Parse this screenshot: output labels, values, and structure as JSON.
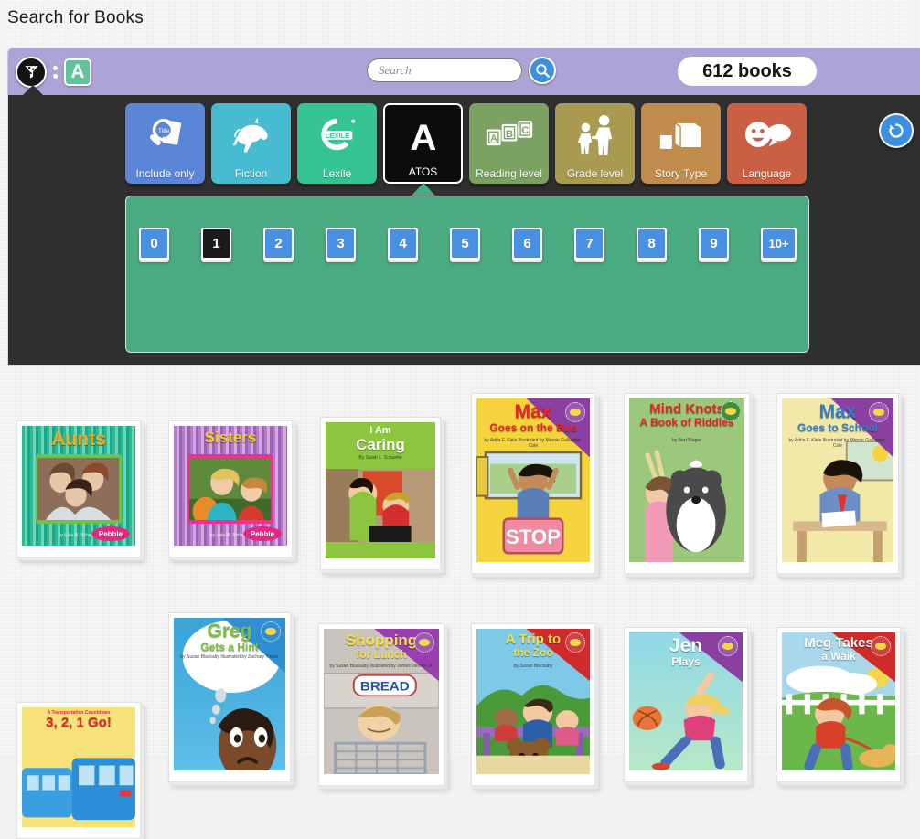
{
  "page": {
    "title": "Search for Books"
  },
  "filter_bar": {
    "funnel_icon": "filter-funnel-icon",
    "separator": ":",
    "active_filter_letter": "A",
    "search": {
      "value": "",
      "placeholder": "Search"
    },
    "search_button_icon": "magnifier-icon",
    "book_count": "612 books"
  },
  "categories": [
    {
      "id": "include-only",
      "label": "Include only",
      "color": "#5b86d8",
      "icon": "magnifier-over-books-icon",
      "selected": false
    },
    {
      "id": "fiction",
      "label": "Fiction",
      "color": "#47bcd0",
      "icon": "unicorn-icon",
      "selected": false
    },
    {
      "id": "lexile",
      "label": "Lexile",
      "color": "#35c495",
      "icon": "lexile-logo-icon",
      "selected": false
    },
    {
      "id": "atos",
      "label": "ATOS",
      "color": "#000000",
      "icon": "letter-a-icon",
      "selected": true
    },
    {
      "id": "reading-level",
      "label": "Reading level",
      "color": "#7ba262",
      "icon": "abc-blocks-icon",
      "selected": false
    },
    {
      "id": "grade-level",
      "label": "Grade level",
      "color": "#a99a52",
      "icon": "two-people-icon",
      "selected": false
    },
    {
      "id": "story-type",
      "label": "Story Type",
      "color": "#c18c4c",
      "icon": "two-books-icon",
      "selected": false
    },
    {
      "id": "language",
      "label": "Language",
      "color": "#ca5f44",
      "icon": "smiley-speech-bubble-icon",
      "selected": false
    }
  ],
  "reset_button": {
    "icon": "reset-undo-icon"
  },
  "atos_levels": {
    "options": [
      {
        "label": "0",
        "selected": false
      },
      {
        "label": "1",
        "selected": true
      },
      {
        "label": "2",
        "selected": false
      },
      {
        "label": "3",
        "selected": false
      },
      {
        "label": "4",
        "selected": false
      },
      {
        "label": "5",
        "selected": false
      },
      {
        "label": "6",
        "selected": false
      },
      {
        "label": "7",
        "selected": false
      },
      {
        "label": "8",
        "selected": false
      },
      {
        "label": "9",
        "selected": false
      },
      {
        "label": "10+",
        "selected": false
      }
    ]
  },
  "books": [
    {
      "title": "Aunts",
      "subtitle": "",
      "byline": "by Lola M. Schaefer",
      "imprint": "Pebble",
      "style": "pebble-green",
      "title_color": "#f7a81b"
    },
    {
      "title": "Sisters",
      "subtitle": "",
      "byline": "by Lola M. Schaefer",
      "imprint": "Pebble",
      "style": "pebble-purple",
      "title_color": "#f7d117"
    },
    {
      "title": "Caring",
      "subtitle": "I Am",
      "byline": "By Sarah L. Schuette",
      "imprint": "",
      "style": "i-am-caring",
      "title_color": "#ffffff"
    },
    {
      "title": "Max",
      "subtitle": "Goes on the Bus",
      "byline": "by Adria F. Klein  Illustrated by Mernie Gallagher-Cole",
      "imprint": "",
      "style": "max-bus",
      "title_color": "#e8252b"
    },
    {
      "title": "Mind Knots",
      "subtitle": "A Book of Riddles",
      "byline": "by Bert Blager",
      "imprint": "",
      "style": "mind-knots",
      "title_color": "#e8252b"
    },
    {
      "title": "Max",
      "subtitle": "Goes to School",
      "byline": "by Adria F. Klein  Illustrated by Mernie Gallagher-Cole",
      "imprint": "",
      "style": "max-school",
      "title_color": "#2f7fd0"
    },
    {
      "title": "3, 2, 1 Go!",
      "subtitle": "A Transportation Countdown",
      "byline": "",
      "imprint": "",
      "style": "go-bus",
      "title_color": "#e02b2b"
    },
    {
      "title": "Greg",
      "subtitle": "Gets a Hint",
      "byline": "by Susan Blackaby  Illustrated by Zachary Trover",
      "imprint": "",
      "style": "greg-hint",
      "title_color": "#7ac143"
    },
    {
      "title": "Shopping",
      "subtitle": "for Lunch",
      "byline": "by Susan Blackaby  Illustrated by James Demski Jr.",
      "imprint": "",
      "style": "shopping-lunch",
      "title_color": "#f5e04a"
    },
    {
      "title": "A Trip to",
      "subtitle": "the Zoo",
      "byline": "by Susan Blackaby",
      "imprint": "",
      "style": "trip-zoo",
      "title_color": "#f5e04a"
    },
    {
      "title": "Jen",
      "subtitle": "Plays",
      "byline": "",
      "imprint": "",
      "style": "jen-plays",
      "title_color": "#ffffff"
    },
    {
      "title": "Meg Takes",
      "subtitle": "a Walk",
      "byline": "",
      "imprint": "",
      "style": "meg-walk",
      "title_color": "#ffffff"
    }
  ],
  "colors": {
    "title_bar": "#aea3d6",
    "panel_dark": "#2f2f2f",
    "panel_green": "#4aab82",
    "accent_blue": "#4a90e2",
    "page_bg": "#f1f1f1"
  }
}
